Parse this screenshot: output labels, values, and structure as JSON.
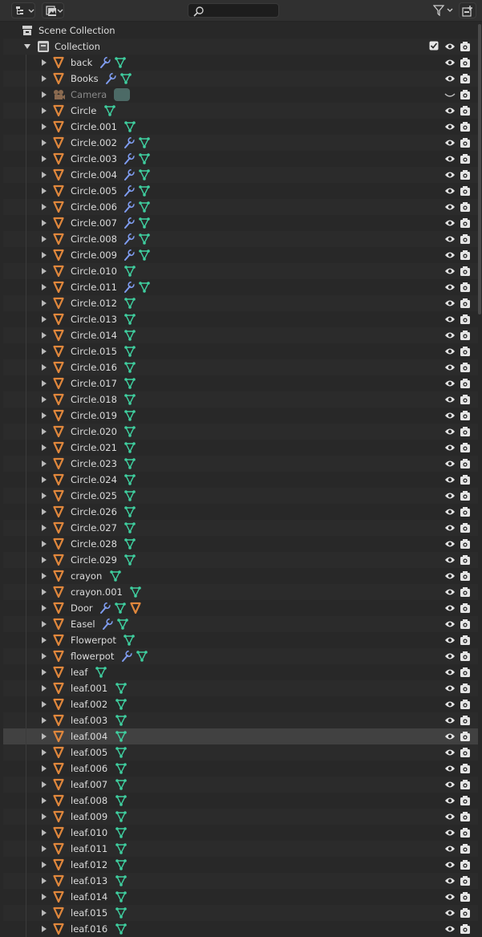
{
  "header": {
    "editor_type_icon": "outliner-icon",
    "display_mode_icon": "view-layer-icon",
    "search_icon": "search-icon",
    "search_placeholder": "",
    "filter_icon": "filter-icon",
    "new_collection_icon": "new-collection-icon"
  },
  "scene_collection": {
    "label": "Scene Collection"
  },
  "collection": {
    "label": "Collection",
    "checked": true
  },
  "objects": [
    {
      "name": "back",
      "modifiers": true,
      "mesh": true
    },
    {
      "name": "Books",
      "modifiers": true,
      "mesh": true
    },
    {
      "name": "Camera",
      "type": "camera",
      "hidden": true
    },
    {
      "name": "Circle",
      "mesh": true
    },
    {
      "name": "Circle.001",
      "mesh": true
    },
    {
      "name": "Circle.002",
      "modifiers": true,
      "mesh": true
    },
    {
      "name": "Circle.003",
      "modifiers": true,
      "mesh": true
    },
    {
      "name": "Circle.004",
      "modifiers": true,
      "mesh": true
    },
    {
      "name": "Circle.005",
      "modifiers": true,
      "mesh": true
    },
    {
      "name": "Circle.006",
      "modifiers": true,
      "mesh": true
    },
    {
      "name": "Circle.007",
      "modifiers": true,
      "mesh": true
    },
    {
      "name": "Circle.008",
      "modifiers": true,
      "mesh": true
    },
    {
      "name": "Circle.009",
      "modifiers": true,
      "mesh": true
    },
    {
      "name": "Circle.010",
      "mesh": true
    },
    {
      "name": "Circle.011",
      "modifiers": true,
      "mesh": true
    },
    {
      "name": "Circle.012",
      "mesh": true
    },
    {
      "name": "Circle.013",
      "mesh": true
    },
    {
      "name": "Circle.014",
      "mesh": true
    },
    {
      "name": "Circle.015",
      "mesh": true
    },
    {
      "name": "Circle.016",
      "mesh": true
    },
    {
      "name": "Circle.017",
      "mesh": true
    },
    {
      "name": "Circle.018",
      "mesh": true
    },
    {
      "name": "Circle.019",
      "mesh": true
    },
    {
      "name": "Circle.020",
      "mesh": true
    },
    {
      "name": "Circle.021",
      "mesh": true
    },
    {
      "name": "Circle.023",
      "mesh": true
    },
    {
      "name": "Circle.024",
      "mesh": true
    },
    {
      "name": "Circle.025",
      "mesh": true
    },
    {
      "name": "Circle.026",
      "mesh": true
    },
    {
      "name": "Circle.027",
      "mesh": true
    },
    {
      "name": "Circle.028",
      "mesh": true
    },
    {
      "name": "Circle.029",
      "mesh": true
    },
    {
      "name": "crayon",
      "mesh": true
    },
    {
      "name": "crayon.001",
      "mesh": true
    },
    {
      "name": "Door",
      "modifiers": true,
      "mesh": true,
      "child_object": true
    },
    {
      "name": "Easel",
      "modifiers": true,
      "mesh": true
    },
    {
      "name": "Flowerpot",
      "mesh": true
    },
    {
      "name": "flowerpot",
      "modifiers": true,
      "mesh": true
    },
    {
      "name": "leaf",
      "mesh": true
    },
    {
      "name": "leaf.001",
      "mesh": true
    },
    {
      "name": "leaf.002",
      "mesh": true
    },
    {
      "name": "leaf.003",
      "mesh": true
    },
    {
      "name": "leaf.004",
      "mesh": true,
      "selected": true
    },
    {
      "name": "leaf.005",
      "mesh": true
    },
    {
      "name": "leaf.006",
      "mesh": true
    },
    {
      "name": "leaf.007",
      "mesh": true
    },
    {
      "name": "leaf.008",
      "mesh": true
    },
    {
      "name": "leaf.009",
      "mesh": true
    },
    {
      "name": "leaf.010",
      "mesh": true
    },
    {
      "name": "leaf.011",
      "mesh": true
    },
    {
      "name": "leaf.012",
      "mesh": true
    },
    {
      "name": "leaf.013",
      "mesh": true
    },
    {
      "name": "leaf.014",
      "mesh": true
    },
    {
      "name": "leaf.015",
      "mesh": true
    },
    {
      "name": "leaf.016",
      "mesh": true
    }
  ],
  "colors": {
    "object_orange": "#e0873c",
    "mesh_green": "#3fd0a0",
    "modifier_blue": "#7f9cf0",
    "background": "#282828"
  }
}
